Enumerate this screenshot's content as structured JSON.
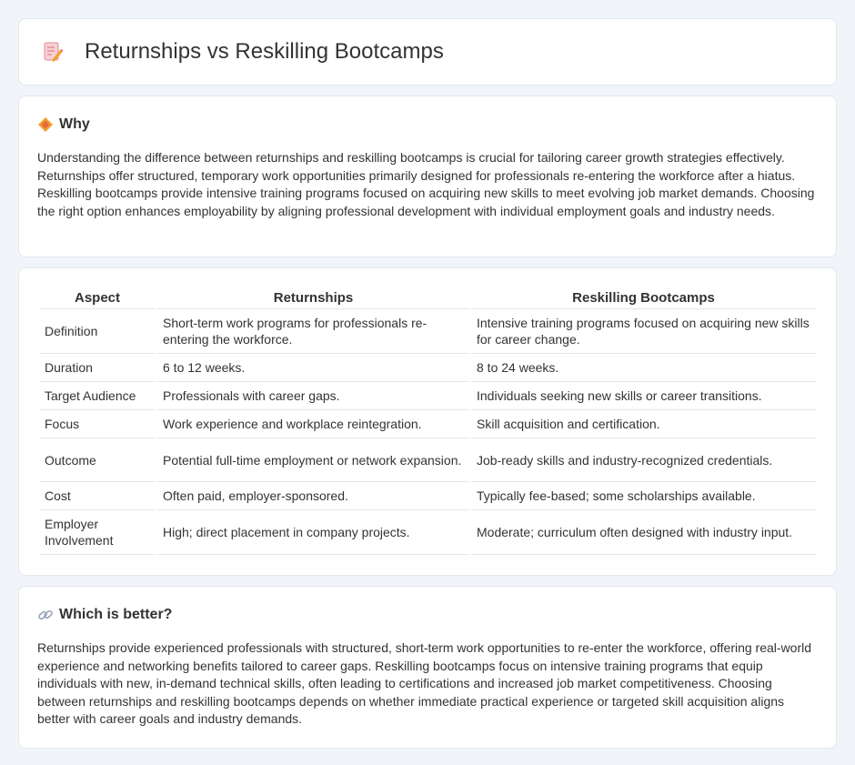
{
  "header": {
    "title": "Returnships vs Reskilling Bootcamps",
    "icon": "document-pencil-icon"
  },
  "why": {
    "heading": "Why",
    "icon": "diamond-icon",
    "text": "Understanding the difference between returnships and reskilling bootcamps is crucial for tailoring career growth strategies effectively. Returnships offer structured, temporary work opportunities primarily designed for professionals re-entering the workforce after a hiatus. Reskilling bootcamps provide intensive training programs focused on acquiring new skills to meet evolving job market demands. Choosing the right option enhances employability by aligning professional development with individual employment goals and industry needs."
  },
  "table": {
    "headers": [
      "Aspect",
      "Returnships",
      "Reskilling Bootcamps"
    ],
    "rows": [
      [
        "Definition",
        "Short-term work programs for professionals re-entering the workforce.",
        "Intensive training programs focused on acquiring new skills for career change."
      ],
      [
        "Duration",
        "6 to 12 weeks.",
        "8 to 24 weeks."
      ],
      [
        "Target Audience",
        "Professionals with career gaps.",
        "Individuals seeking new skills or career transitions."
      ],
      [
        "Focus",
        "Work experience and workplace reintegration.",
        "Skill acquisition and certification."
      ],
      [
        "Outcome",
        "Potential full-time employment or network expansion.",
        "Job-ready skills and industry-recognized credentials."
      ],
      [
        "Cost",
        "Often paid, employer-sponsored.",
        "Typically fee-based; some scholarships available."
      ],
      [
        "Employer Involvement",
        "High; direct placement in company projects.",
        "Moderate; curriculum often designed with industry input."
      ]
    ]
  },
  "better": {
    "heading": "Which is better?",
    "icon": "link-icon",
    "text": "Returnships provide experienced professionals with structured, short-term work opportunities to re-enter the workforce, offering real-world experience and networking benefits tailored to career gaps. Reskilling bootcamps focus on intensive training programs that equip individuals with new, in-demand technical skills, often leading to certifications and increased job market competitiveness. Choosing between returnships and reskilling bootcamps depends on whether immediate practical experience or targeted skill acquisition aligns better with career goals and industry demands."
  },
  "colors": {
    "background": "#f1f4f9",
    "card": "#ffffff",
    "accent_orange": "#f0a030",
    "icon_pink": "#e86a7a"
  }
}
